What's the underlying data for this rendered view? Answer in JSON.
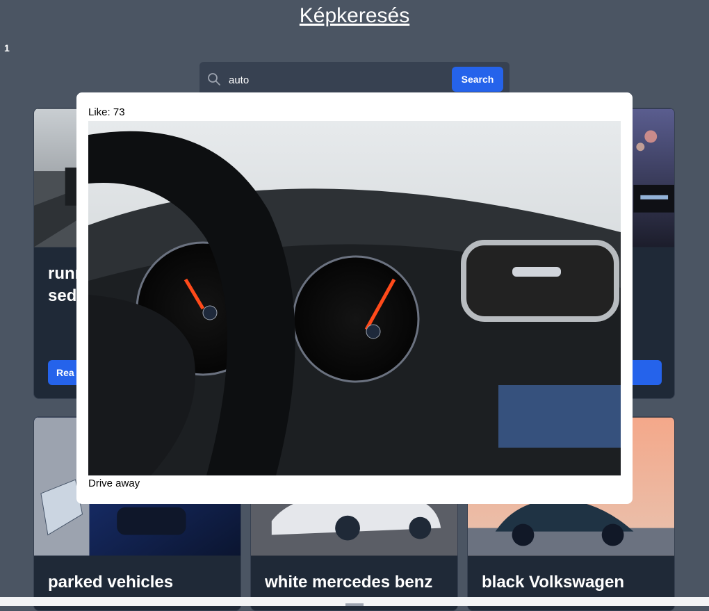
{
  "header": {
    "title": "Képkeresés",
    "page_number": "1"
  },
  "search": {
    "value": "auto",
    "button_label": "Search",
    "icon": "search-icon"
  },
  "cards": [
    {
      "title_lines": [
        "runn",
        "seda"
      ],
      "button_label": "Rea"
    },
    {
      "title_lines": [
        "parked vehicles"
      ]
    },
    {
      "title_lines": [
        "white mercedes benz"
      ]
    },
    {
      "title_lines": [
        "black Volkswagen"
      ]
    }
  ],
  "modal": {
    "like_text": "Like: 73",
    "description": "Drive away",
    "image": "car-dashboard-steering-wheel-speedometer"
  },
  "colors": {
    "background": "#4b5563",
    "card": "#1f2937",
    "accent": "#2563eb",
    "modal": "#ffffff"
  }
}
